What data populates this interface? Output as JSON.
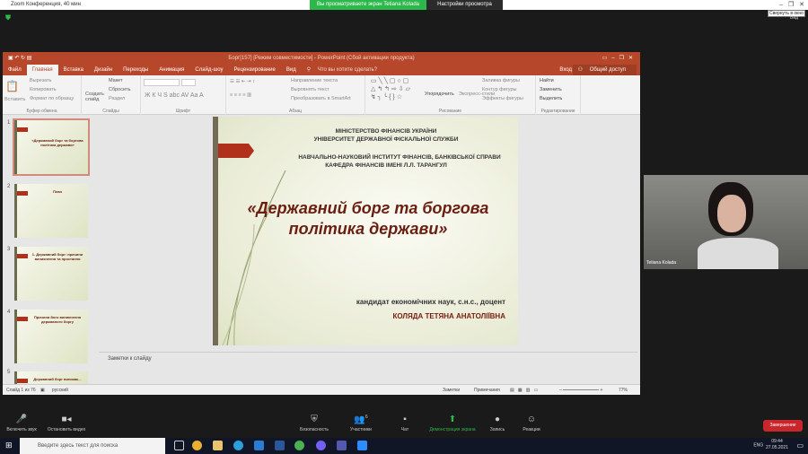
{
  "zoom": {
    "window_title": "Zoom Конференция, 40 мин",
    "banner": "Вы просматриваете экран Tetiana Kolada",
    "view_options": "Настройки просмотра",
    "tooltip": "Свернуть в окно",
    "view_label": "Вид",
    "toolbar": [
      {
        "label": "Включить звук",
        "icon": "mic-muted-icon"
      },
      {
        "label": "Остановить видео",
        "icon": "video-icon"
      },
      {
        "label": "Безопасность",
        "icon": "shield-icon"
      },
      {
        "label": "Участники",
        "icon": "participants-icon",
        "count": "6"
      },
      {
        "label": "Чат",
        "icon": "chat-icon"
      },
      {
        "label": "Демонстрация экрана",
        "icon": "share-screen-icon"
      },
      {
        "label": "Запись",
        "icon": "record-icon"
      },
      {
        "label": "Реакции",
        "icon": "reaction-icon"
      }
    ],
    "end_button": "Завершение",
    "participant_name": "Tetiana Kolada",
    "accent": "#2db84b"
  },
  "ppt": {
    "title": "Борг[157] [Режим совместимости] - PowerPoint (Сбой активации продукта)",
    "tabs": [
      "Файл",
      "Главная",
      "Вставка",
      "Дизайн",
      "Переходы",
      "Анимация",
      "Слайд-шоу",
      "Рецензирование",
      "Вид"
    ],
    "tell_me": "Что вы хотите сделать?",
    "signin": "Вход",
    "share": "Общий доступ",
    "ribbon": {
      "clipboard": {
        "paste": "Вставить",
        "cut": "Вырезать",
        "copy": "Копировать",
        "format": "Формат по образцу",
        "label": "Буфер обмена"
      },
      "slides": {
        "new": "Создать слайд",
        "layout": "Макет",
        "reset": "Сбросить",
        "section": "Раздел",
        "label": "Слайды"
      },
      "font": {
        "label": "Шрифт"
      },
      "paragraph": {
        "dir": "Направление текста",
        "align": "Выровнять текст",
        "smartart": "Преобразовать в SmartArt",
        "label": "Абзац"
      },
      "drawing": {
        "arrange": "Упорядочить",
        "styles": "Экспресс-стили",
        "fill": "Заливка фигуры",
        "outline": "Контур фигуры",
        "effects": "Эффекты фигуры",
        "label": "Рисование"
      },
      "editing": {
        "find": "Найти",
        "replace": "Заменить",
        "select": "Выделить",
        "label": "Редактирование"
      }
    },
    "thumbs": [
      {
        "n": "1",
        "title": "«Державний борг та боргова політика держави»"
      },
      {
        "n": "2",
        "title": "План"
      },
      {
        "n": "3",
        "title": "1. Державний борг: причини виникнення та простання"
      },
      {
        "n": "4",
        "title": "Причини його виникнення державного боргу"
      },
      {
        "n": "5",
        "title": "Державний борг виникає..."
      }
    ],
    "slide": {
      "l1": "МІНІСТЕРСТВО ФІНАНСІВ УКРАЇНИ",
      "l2": "УНІВЕРСИТЕТ ДЕРЖАВНОЇ ФІСКАЛЬНОЇ СЛУЖБИ",
      "l3": "НАВЧАЛЬНО-НАУКОВИЙ ІНСТИТУТ ФІНАНСІВ, БАНКІВСЬКОЇ СПРАВИ",
      "l4": "КАФЕДРА ФІНАНСІВ ІМЕНІ Л.Л. ТАРАНГУЛ",
      "title1": "«Державний борг та боргова",
      "title2": "політика держави»",
      "author_role": "кандидат економічних наук, с.н.с., доцент",
      "author_name": "КОЛЯДА ТЕТЯНА АНАТОЛІЇВНА"
    },
    "notes_placeholder": "Заметки к слайду",
    "status": {
      "slide": "Слайд 1 из 76",
      "lang": "русский",
      "notes": "Заметки",
      "comments": "Примечания",
      "zoom": "77%",
      "zoom_fraction": 0.77
    }
  },
  "taskbar": {
    "search_placeholder": "Введите здесь текст для поиска",
    "lang": "ENG",
    "time": "09:44",
    "date": "27.05.2021"
  }
}
